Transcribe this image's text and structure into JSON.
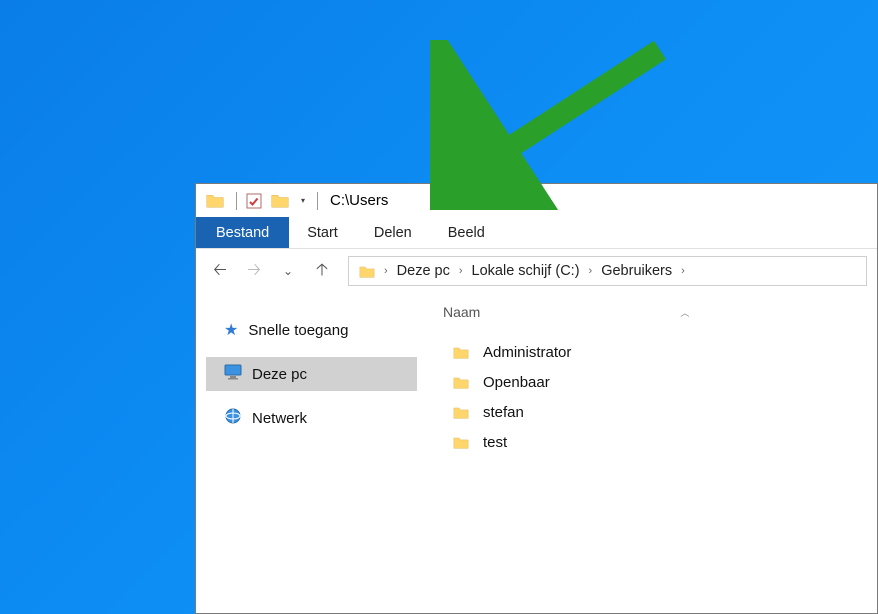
{
  "titlebar": {
    "title": "C:\\Users"
  },
  "ribbon": {
    "file_tab": "Bestand",
    "tabs": [
      "Start",
      "Delen",
      "Beeld"
    ]
  },
  "breadcrumb": {
    "segments": [
      "Deze pc",
      "Lokale schijf (C:)",
      "Gebruikers"
    ]
  },
  "navpane": {
    "quick_access": "Snelle toegang",
    "this_pc": "Deze pc",
    "network": "Netwerk"
  },
  "content": {
    "column_name": "Naam",
    "items": [
      "Administrator",
      "Openbaar",
      "stefan",
      "test"
    ]
  }
}
